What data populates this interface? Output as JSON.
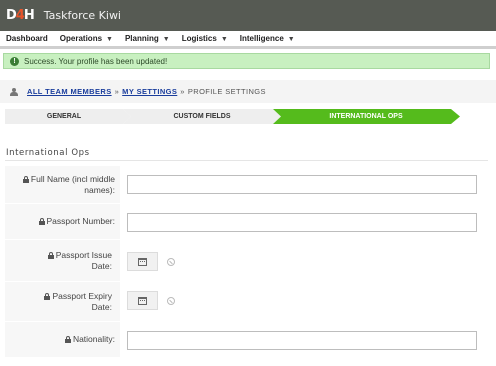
{
  "app": {
    "logo_text": "D4H",
    "title": "Taskforce Kiwi"
  },
  "nav": {
    "items": [
      {
        "label": "Dashboard",
        "has_caret": false
      },
      {
        "label": "Operations",
        "has_caret": true
      },
      {
        "label": "Planning",
        "has_caret": true
      },
      {
        "label": "Logistics",
        "has_caret": true
      },
      {
        "label": "Intelligence",
        "has_caret": true
      }
    ],
    "caret_icon": "chevron-down-icon"
  },
  "alert": {
    "icon": "info-icon",
    "message": "Success. Your profile has been updated!",
    "color": "#c8f0c0"
  },
  "breadcrumb": {
    "icon": "user-icon",
    "items": [
      "ALL TEAM MEMBERS",
      "MY SETTINGS",
      "PROFILE SETTINGS"
    ],
    "separator": "»"
  },
  "steps": {
    "items": [
      "GENERAL",
      "CUSTOM FIELDS",
      "INTERNATIONAL OPS"
    ],
    "active_index": 2,
    "active_color": "#55bb1c",
    "inactive_color": "#eeeeee"
  },
  "section": {
    "title": "International Ops"
  },
  "form": {
    "lock_icon": "lock-icon",
    "fields": [
      {
        "label": "Full Name (incl middle names):",
        "type": "text",
        "value": ""
      },
      {
        "label": "Passport Number:",
        "type": "text",
        "value": ""
      },
      {
        "label": "Passport Issue Date:",
        "type": "date",
        "value": ""
      },
      {
        "label": "Passport Expiry Date:",
        "type": "date",
        "value": ""
      },
      {
        "label": "Nationality:",
        "type": "text",
        "value": ""
      }
    ]
  }
}
